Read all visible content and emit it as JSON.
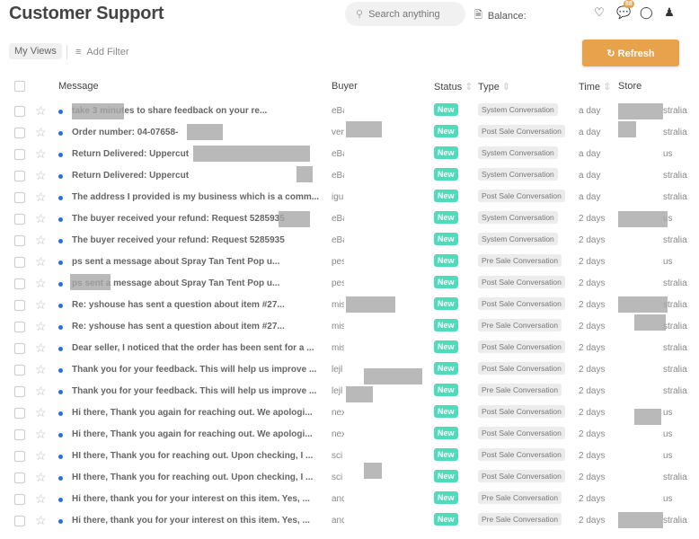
{
  "header": {
    "title": "Customer Support",
    "search_placeholder": "Search anything",
    "balance_label": "Balance:",
    "notification_count": "88"
  },
  "toolbar": {
    "my_views": "My Views",
    "add_filter": "Add Filter",
    "refresh": "Refresh"
  },
  "colors": {
    "accent": "#e8a24b",
    "status_new": "#4fdcb8",
    "unread_dot": "#2a6fe0"
  },
  "columns": {
    "message": "Message",
    "buyer": "Buyer",
    "status": "Status",
    "type": "Type",
    "time": "Time",
    "store": "Store"
  },
  "rows": [
    {
      "message": "take 3 minutes to share feedback on your re...",
      "buyer": "eBa",
      "status": "New",
      "type": "System Conversation",
      "time": "a day",
      "store": "stralia"
    },
    {
      "message": "Order number: 04-07658-",
      "buyer": "ver",
      "status": "New",
      "type": "Post Sale Conversation",
      "time": "a day",
      "store": "stralia"
    },
    {
      "message": "Return Delivered: Uppercut",
      "buyer": "eBa",
      "status": "New",
      "type": "System Conversation",
      "time": "a day",
      "store": "us"
    },
    {
      "message": "Return Delivered: Uppercut",
      "buyer": "eBa",
      "status": "New",
      "type": "System Conversation",
      "time": "a day",
      "store": "stralia"
    },
    {
      "message": "The address I provided is my business which is a comm...",
      "buyer": "igu",
      "status": "New",
      "type": "Post Sale Conversation",
      "time": "a day",
      "store": "stralia"
    },
    {
      "message": "The buyer received your refund: Request 5285935",
      "buyer": "eBa",
      "status": "New",
      "type": "System Conversation",
      "time": "2 days",
      "store": "us"
    },
    {
      "message": "The buyer received your refund: Request 5285935",
      "buyer": "eBa",
      "status": "New",
      "type": "System Conversation",
      "time": "2 days",
      "store": "stralia"
    },
    {
      "message": "ps sent a message about Spray Tan Tent Pop u...",
      "buyer": "pes",
      "status": "New",
      "type": "Pre Sale Conversation",
      "time": "2 days",
      "store": "us"
    },
    {
      "message": "ps sent a message about Spray Tan Tent Pop u...",
      "buyer": "pes",
      "status": "New",
      "type": "Post Sale Conversation",
      "time": "2 days",
      "store": "stralia"
    },
    {
      "message": "Re:        yshouse has sent a question about item #27...",
      "buyer": "mis",
      "status": "New",
      "type": "Post Sale Conversation",
      "time": "2 days",
      "store": "stralia"
    },
    {
      "message": "Re:        yshouse has sent a question about item #27...",
      "buyer": "mis",
      "status": "New",
      "type": "Pre Sale Conversation",
      "time": "2 days",
      "store": "stralia"
    },
    {
      "message": "Dear seller, I noticed that the order has been sent for a ...",
      "buyer": "mis",
      "status": "New",
      "type": "Post Sale Conversation",
      "time": "2 days",
      "store": "stralia"
    },
    {
      "message": "Thank you for your feedback. This will help us improve ...",
      "buyer": "lejl",
      "status": "New",
      "type": "Post Sale Conversation",
      "time": "2 days",
      "store": "stralia"
    },
    {
      "message": "Thank you for your feedback. This will help us improve ...",
      "buyer": "lejl",
      "status": "New",
      "type": "Pre Sale Conversation",
      "time": "2 days",
      "store": "stralia"
    },
    {
      "message": "Hi there,   Thank you again for reaching out. We apologi...",
      "buyer": "nex",
      "status": "New",
      "type": "Post Sale Conversation",
      "time": "2 days",
      "store": "us"
    },
    {
      "message": "Hi there,   Thank you again for reaching out. We apologi...",
      "buyer": "nex",
      "status": "New",
      "type": "Post Sale Conversation",
      "time": "2 days",
      "store": "us"
    },
    {
      "message": "HI there,   Thank you for reaching out. Upon checking, I ...",
      "buyer": "sci",
      "status": "New",
      "type": "Post Sale Conversation",
      "time": "2 days",
      "store": "us"
    },
    {
      "message": "HI there,   Thank you for reaching out. Upon checking, I ...",
      "buyer": "sci",
      "status": "New",
      "type": "Post Sale Conversation",
      "time": "2 days",
      "store": "stralia"
    },
    {
      "message": "Hi there,   thank you for your interest on this item. Yes, ...",
      "buyer": "and",
      "status": "New",
      "type": "Pre Sale Conversation",
      "time": "2 days",
      "store": "us"
    },
    {
      "message": "Hi there,   thank you for your interest on this item. Yes, ...",
      "buyer": "and",
      "status": "New",
      "type": "Pre Sale Conversation",
      "time": "2 days",
      "store": "stralia"
    }
  ]
}
